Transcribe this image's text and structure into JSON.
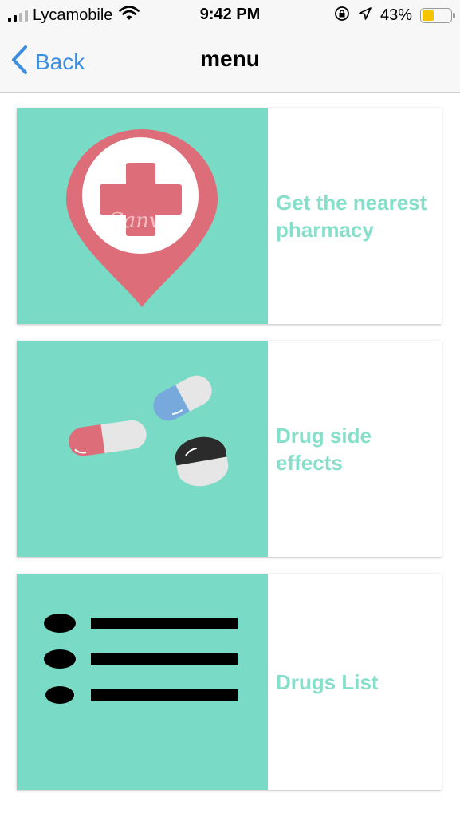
{
  "status_bar": {
    "carrier": "Lycamobile",
    "time": "9:42 PM",
    "battery_percent": "43%",
    "battery_level": 0.43,
    "battery_color": "#f5c400",
    "icons": [
      "signal-icon",
      "wifi-icon",
      "orientation-lock-icon",
      "location-arrow-icon",
      "battery-icon"
    ]
  },
  "nav": {
    "back_label": "Back",
    "title": "menu",
    "accent_color": "#3d8ee0"
  },
  "menu": {
    "tile_color": "#79dbc6",
    "label_color": "#86dfca",
    "items": [
      {
        "label_lines": [
          "Get the nearest",
          "pharmacy"
        ],
        "icon": "pharmacy-location-pin-icon",
        "watermark": "Canva"
      },
      {
        "label_lines": [
          "Drug side",
          "effects"
        ],
        "icon": "pills-icon"
      },
      {
        "label_lines": [
          "Drugs List"
        ],
        "icon": "list-icon"
      }
    ]
  }
}
